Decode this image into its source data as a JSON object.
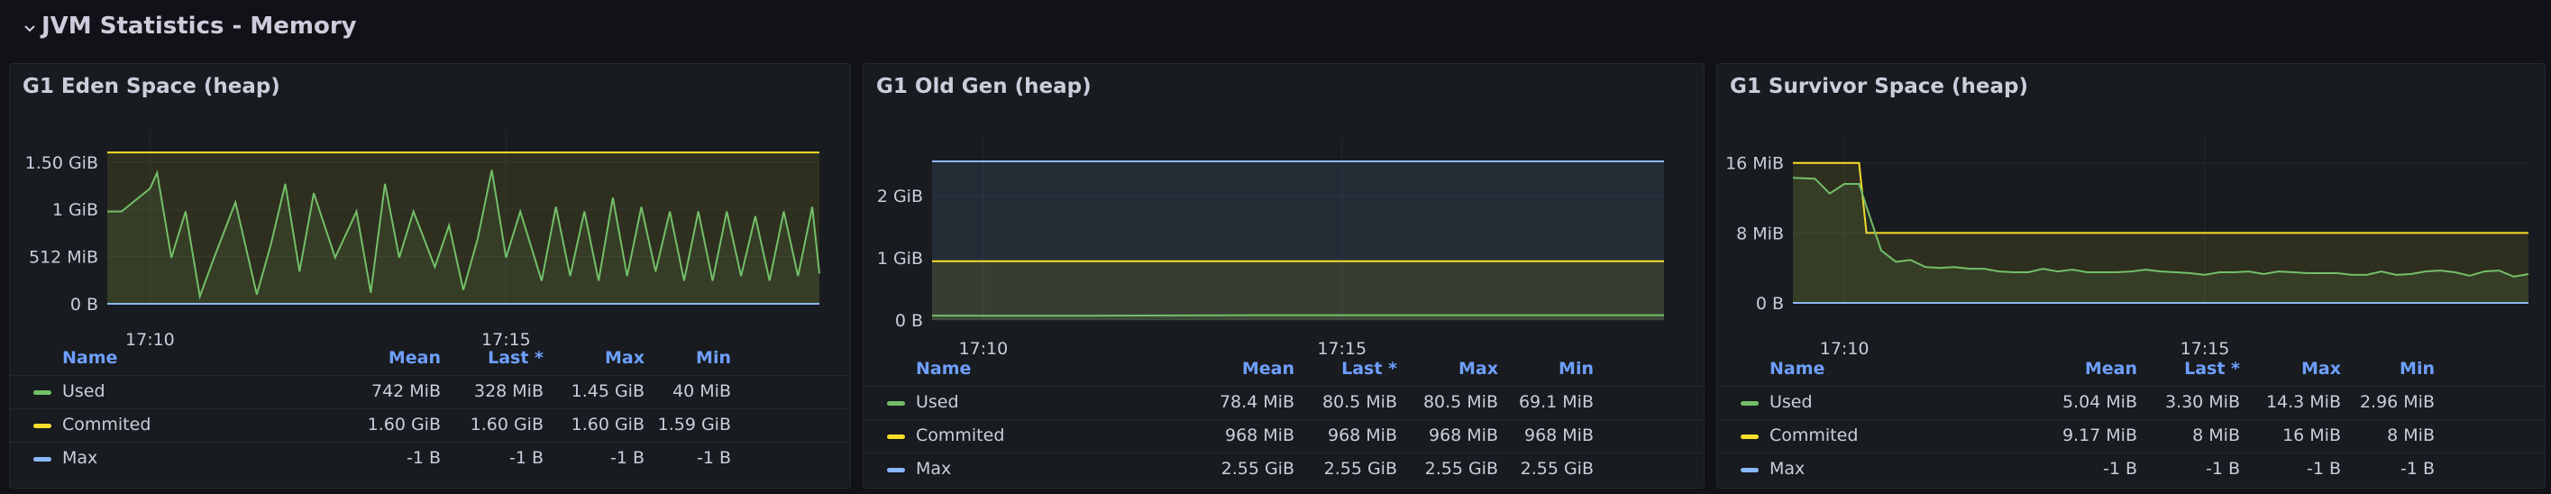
{
  "row": {
    "title": "JVM Statistics - Memory"
  },
  "legend_columns": {
    "name": "Name",
    "mean": "Mean",
    "last": "Last *",
    "max": "Max",
    "min": "Min"
  },
  "colors": {
    "used": "#73bf69",
    "commited": "#fade2a",
    "max": "#8ab8ff",
    "grid": "#2a2d33",
    "text": "#ccccdc",
    "header": "#6e9fff"
  },
  "panels": [
    {
      "title": "G1 Eden Space (heap)",
      "chart_data": {
        "type": "line",
        "x_ticks": [
          "17:10",
          "17:15"
        ],
        "y_ticks": [
          "0 B",
          "512 MiB",
          "1 GiB",
          "1.50 GiB"
        ],
        "y_tick_values": [
          0,
          512,
          1024,
          1536
        ],
        "ylim": [
          0,
          1700
        ],
        "x_range": [
          0,
          100
        ],
        "x_tick_positions": [
          6,
          56
        ],
        "series": [
          {
            "name": "Used",
            "color": "#73bf69",
            "x": [
              0,
              2,
              6,
              7,
              9,
              11,
              13,
              15,
              18,
              21,
              23,
              25,
              27,
              29,
              32,
              35,
              37,
              39,
              41,
              43,
              46,
              48,
              50,
              52,
              54,
              56,
              58,
              61,
              63,
              65,
              67,
              69,
              71,
              73,
              75,
              77,
              79,
              81,
              83,
              85,
              87,
              89,
              91,
              93,
              95,
              97,
              99,
              100
            ],
            "values": [
              1000,
              1000,
              1250,
              1420,
              500,
              1000,
              80,
              500,
              1100,
              100,
              650,
              1300,
              350,
              1200,
              500,
              1000,
              120,
              1300,
              500,
              1000,
              400,
              850,
              150,
              700,
              1450,
              500,
              1000,
              250,
              1050,
              300,
              1000,
              250,
              1150,
              300,
              1050,
              350,
              1000,
              250,
              1000,
              250,
              1000,
              300,
              950,
              250,
              1000,
              300,
              1050,
              328
            ]
          },
          {
            "name": "Commited",
            "color": "#fade2a",
            "x": [
              0,
              100
            ],
            "values": [
              1640,
              1640
            ]
          },
          {
            "name": "Max",
            "color": "#8ab8ff",
            "x": [
              0,
              100
            ],
            "values": [
              0,
              0
            ]
          }
        ]
      },
      "legend": [
        {
          "name": "Used",
          "mean": "742 MiB",
          "last": "328 MiB",
          "max": "1.45 GiB",
          "min": "40 MiB"
        },
        {
          "name": "Commited",
          "mean": "1.60 GiB",
          "last": "1.60 GiB",
          "max": "1.60 GiB",
          "min": "1.59 GiB"
        },
        {
          "name": "Max",
          "mean": "-1 B",
          "last": "-1 B",
          "max": "-1 B",
          "min": "-1 B"
        }
      ]
    },
    {
      "title": "G1 Old Gen (heap)",
      "chart_data": {
        "type": "area",
        "x_ticks": [
          "17:10",
          "17:15"
        ],
        "y_ticks": [
          "0 B",
          "1 GiB",
          "2 GiB"
        ],
        "y_tick_values": [
          0,
          1024,
          2048
        ],
        "ylim": [
          0,
          2700
        ],
        "x_range": [
          0,
          100
        ],
        "x_tick_positions": [
          7,
          56
        ],
        "series": [
          {
            "name": "Used",
            "color": "#73bf69",
            "x": [
              0,
              20,
              40,
              60,
              80,
              100
            ],
            "values": [
              72,
              69,
              78,
              80,
              80,
              80
            ]
          },
          {
            "name": "Commited",
            "color": "#fade2a",
            "x": [
              0,
              100
            ],
            "values": [
              968,
              968
            ]
          },
          {
            "name": "Max",
            "color": "#8ab8ff",
            "x": [
              0,
              100
            ],
            "values": [
              2611,
              2611
            ]
          }
        ]
      },
      "legend": [
        {
          "name": "Used",
          "mean": "78.4 MiB",
          "last": "80.5 MiB",
          "max": "80.5 MiB",
          "min": "69.1 MiB"
        },
        {
          "name": "Commited",
          "mean": "968 MiB",
          "last": "968 MiB",
          "max": "968 MiB",
          "min": "968 MiB"
        },
        {
          "name": "Max",
          "mean": "2.55 GiB",
          "last": "2.55 GiB",
          "max": "2.55 GiB",
          "min": "2.55 GiB"
        }
      ]
    },
    {
      "title": "G1 Survivor Space (heap)",
      "chart_data": {
        "type": "line",
        "x_ticks": [
          "17:10",
          "17:15"
        ],
        "y_ticks": [
          "0 B",
          "8 MiB",
          "16 MiB"
        ],
        "y_tick_values": [
          0,
          8,
          16
        ],
        "ylim": [
          0,
          17
        ],
        "x_range": [
          0,
          100
        ],
        "x_tick_positions": [
          7,
          56
        ],
        "series": [
          {
            "name": "Used",
            "color": "#73bf69",
            "x": [
              0,
              3,
              5,
              7,
              9,
              10,
              12,
              14,
              16,
              18,
              20,
              22,
              24,
              26,
              28,
              30,
              32,
              34,
              36,
              38,
              40,
              42,
              44,
              46,
              48,
              50,
              52,
              54,
              56,
              58,
              60,
              62,
              64,
              66,
              68,
              70,
              72,
              74,
              76,
              78,
              80,
              82,
              84,
              86,
              88,
              90,
              92,
              94,
              96,
              98,
              100
            ],
            "values": [
              14.3,
              14.2,
              12.5,
              13.6,
              13.6,
              11,
              6,
              4.7,
              4.9,
              4.1,
              4.0,
              4.1,
              3.9,
              3.9,
              3.6,
              3.5,
              3.5,
              3.9,
              3.6,
              3.8,
              3.5,
              3.5,
              3.5,
              3.6,
              3.8,
              3.6,
              3.5,
              3.4,
              3.2,
              3.5,
              3.5,
              3.6,
              3.3,
              3.6,
              3.5,
              3.4,
              3.4,
              3.4,
              3.2,
              3.2,
              3.6,
              3.2,
              3.3,
              3.6,
              3.7,
              3.5,
              3.1,
              3.6,
              3.7,
              3.0,
              3.3
            ]
          },
          {
            "name": "Commited",
            "color": "#fade2a",
            "x": [
              0,
              9,
              10,
              100
            ],
            "values": [
              16,
              16,
              8,
              8
            ]
          },
          {
            "name": "Max",
            "color": "#8ab8ff",
            "x": [
              0,
              100
            ],
            "values": [
              0,
              0
            ]
          }
        ]
      },
      "legend": [
        {
          "name": "Used",
          "mean": "5.04 MiB",
          "last": "3.30 MiB",
          "max": "14.3 MiB",
          "min": "2.96 MiB"
        },
        {
          "name": "Commited",
          "mean": "9.17 MiB",
          "last": "8 MiB",
          "max": "16 MiB",
          "min": "8 MiB"
        },
        {
          "name": "Max",
          "mean": "-1 B",
          "last": "-1 B",
          "max": "-1 B",
          "min": "-1 B"
        }
      ]
    }
  ]
}
